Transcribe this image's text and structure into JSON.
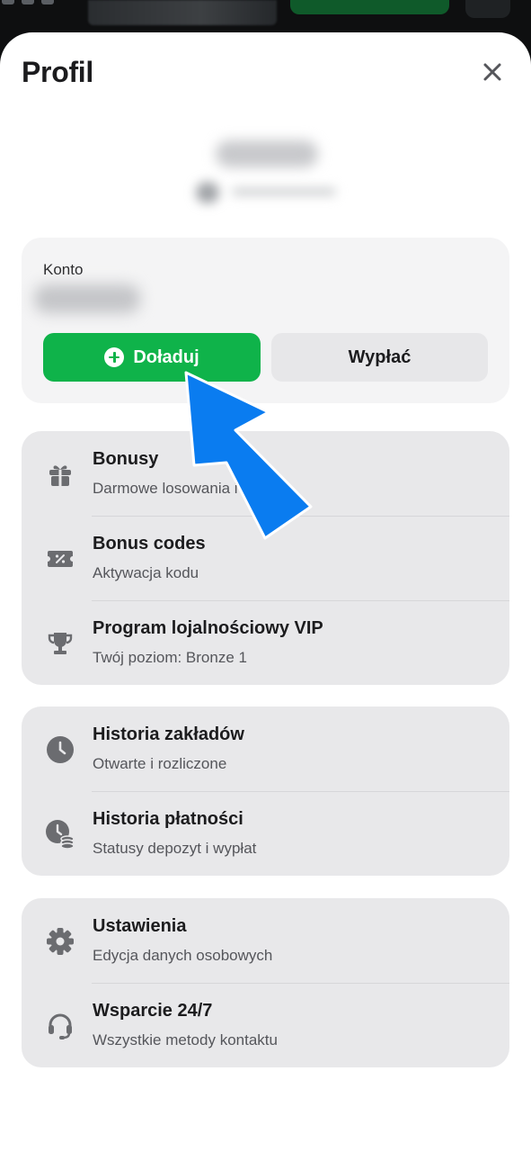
{
  "header": {
    "title": "Profil"
  },
  "account": {
    "label": "Konto",
    "deposit_label": "Doładuj",
    "withdraw_label": "Wypłać"
  },
  "menu_group_1": [
    {
      "icon": "gift-icon",
      "title": "Bonusy",
      "subtitle": "Darmowe losowania i oferty"
    },
    {
      "icon": "ticket-percent-icon",
      "title": "Bonus codes",
      "subtitle": "Aktywacja kodu"
    },
    {
      "icon": "trophy-icon",
      "title": "Program lojalnościowy VIP",
      "subtitle": "Twój poziom: Bronze 1"
    }
  ],
  "menu_group_2": [
    {
      "icon": "clock-icon",
      "title": "Historia zakładów",
      "subtitle": "Otwarte i rozliczone"
    },
    {
      "icon": "clock-coins-icon",
      "title": "Historia płatności",
      "subtitle": "Statusy depozyt i wypłat"
    }
  ],
  "menu_group_3": [
    {
      "icon": "gear-icon",
      "title": "Ustawienia",
      "subtitle": "Edycja danych osobowych"
    },
    {
      "icon": "headset-icon",
      "title": "Wsparcie 24/7",
      "subtitle": "Wszystkie metody kontaktu"
    }
  ],
  "colors": {
    "deposit_green": "#0fb34a",
    "pointer_arrow_blue": "#0a7cf0",
    "card_grey": "#e8e8ea"
  }
}
